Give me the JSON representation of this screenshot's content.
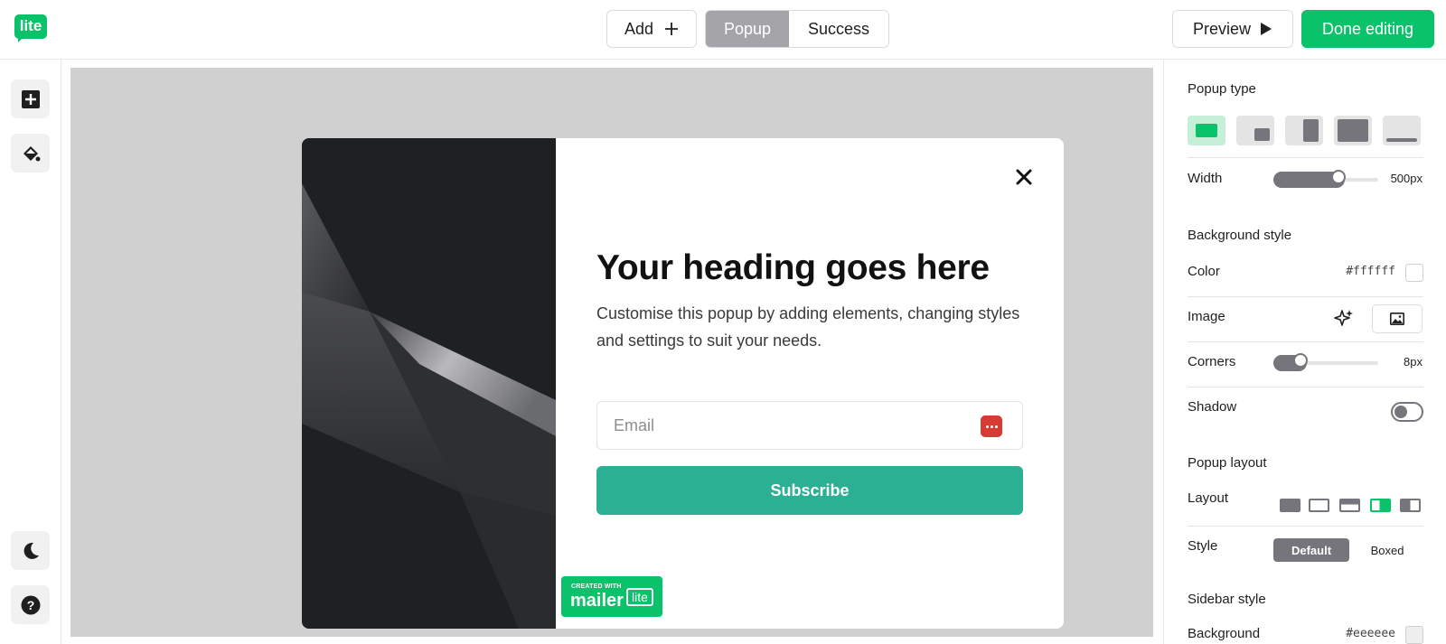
{
  "header": {
    "logo_text": "lite",
    "add_label": "Add",
    "tabs": [
      {
        "label": "Popup",
        "active": true
      },
      {
        "label": "Success",
        "active": false
      }
    ],
    "preview_label": "Preview",
    "done_label": "Done editing"
  },
  "left_rail": {
    "items": [
      {
        "icon": "add-block-icon"
      },
      {
        "icon": "paint-bucket-icon"
      },
      {
        "icon": "moon-icon"
      },
      {
        "icon": "help-icon"
      }
    ]
  },
  "popup": {
    "heading": "Your heading goes here",
    "text": "Customise this popup by adding elements, changing styles and settings to suit your needs.",
    "email_placeholder": "Email",
    "subscribe_label": "Subscribe",
    "close_icon": "close-icon"
  },
  "badge": {
    "line1": "CREATED WITH",
    "line2": "mailer",
    "line3": "lite"
  },
  "settings": {
    "popup_type": {
      "title": "Popup type",
      "selected_index": 0,
      "options": [
        "center-popup-icon",
        "corner-popup-icon",
        "side-popup-icon",
        "fullscreen-popup-icon",
        "bar-popup-icon"
      ]
    },
    "width": {
      "label": "Width",
      "value": "500px",
      "fraction": 0.6
    },
    "background_style": {
      "title": "Background style",
      "color_label": "Color",
      "color_value": "#ffffff",
      "image_label": "Image"
    },
    "corners": {
      "label": "Corners",
      "value": "8px",
      "fraction": 0.24
    },
    "shadow": {
      "label": "Shadow",
      "on": false
    },
    "popup_layout": {
      "title": "Popup layout",
      "layout_label": "Layout",
      "selected_index": 3,
      "options": [
        "layout-full-icon",
        "layout-outline-icon",
        "layout-band-icon",
        "layout-image-left-icon",
        "layout-image-right-icon"
      ],
      "style_label": "Style",
      "style_options": [
        "Default",
        "Boxed"
      ],
      "style_selected": "Default"
    },
    "sidebar_style": {
      "title": "Sidebar style",
      "background_label": "Background",
      "background_value": "#eeeeee"
    }
  },
  "colors": {
    "brand": "#09c269",
    "subscribe": "#2bb093",
    "canvas": "#d0d0d0",
    "accent_gray": "#75757b"
  }
}
